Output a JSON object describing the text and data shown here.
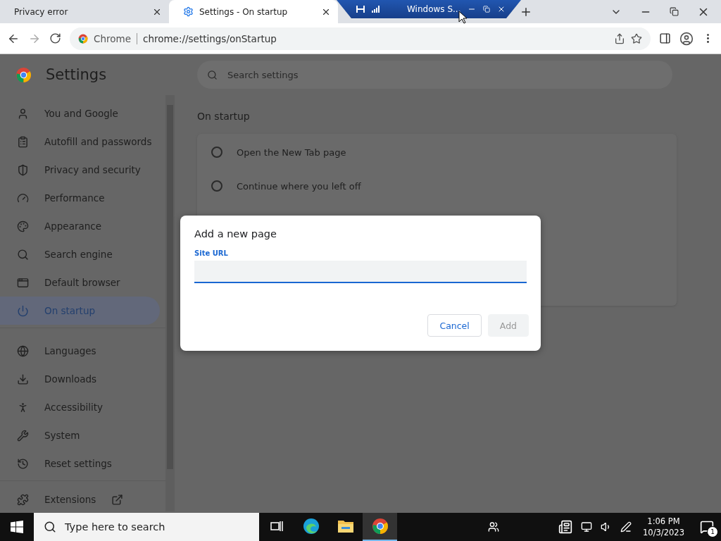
{
  "tabs": [
    {
      "label": "Privacy error",
      "selected": false
    },
    {
      "label": "Settings - On startup",
      "selected": true
    }
  ],
  "remote_bar": {
    "title": "Windows S..."
  },
  "address_bar": {
    "chip": "Chrome",
    "url": "chrome://settings/onStartup"
  },
  "settings": {
    "title": "Settings",
    "search": {
      "placeholder": "Search settings"
    },
    "sidebar": {
      "groups": [
        {
          "items": [
            {
              "label": "You and Google",
              "selected": false
            },
            {
              "label": "Autofill and passwords",
              "selected": false
            },
            {
              "label": "Privacy and security",
              "selected": false
            },
            {
              "label": "Performance",
              "selected": false
            },
            {
              "label": "Appearance",
              "selected": false
            },
            {
              "label": "Search engine",
              "selected": false
            },
            {
              "label": "Default browser",
              "selected": false
            },
            {
              "label": "On startup",
              "selected": true
            }
          ]
        },
        {
          "items": [
            {
              "label": "Languages",
              "selected": false
            },
            {
              "label": "Downloads",
              "selected": false
            },
            {
              "label": "Accessibility",
              "selected": false
            },
            {
              "label": "System",
              "selected": false
            },
            {
              "label": "Reset settings",
              "selected": false
            }
          ]
        },
        {
          "items": [
            {
              "label": "Extensions",
              "selected": false
            }
          ]
        }
      ]
    },
    "section_title": "On startup",
    "options": [
      {
        "label": "Open the New Tab page",
        "selected": false
      },
      {
        "label": "Continue where you left off",
        "selected": false
      }
    ]
  },
  "dialog": {
    "title": "Add a new page",
    "field": {
      "label": "Site URL"
    },
    "buttons": [
      {
        "label": "Cancel",
        "disabled": false
      },
      {
        "label": "Add",
        "disabled": true
      }
    ]
  },
  "taskbar": {
    "search": {
      "placeholder": "Type here to search"
    },
    "apps": [
      {
        "selected": false
      },
      {
        "selected": false
      },
      {
        "selected": false
      },
      {
        "selected": true
      }
    ],
    "time": "1:06 PM",
    "date": "10/3/2023",
    "notifications": "1"
  }
}
